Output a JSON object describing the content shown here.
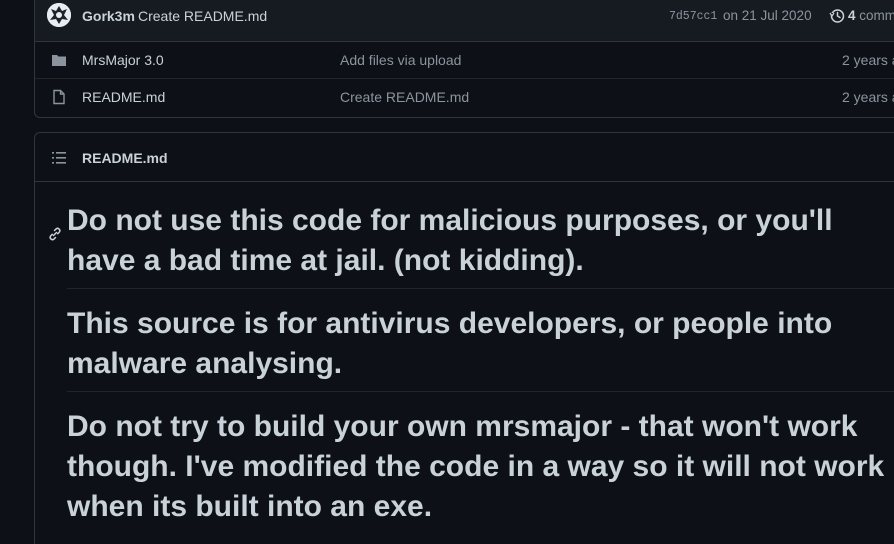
{
  "commit": {
    "author": "Gork3m",
    "message": "Create README.md",
    "sha": "7d57cc1",
    "date": "on 21 Jul 2020",
    "count": "4",
    "count_label": "comm"
  },
  "files": [
    {
      "name": "MrsMajor 3.0",
      "type": "folder",
      "commit": "Add files via upload",
      "age": "2 years a"
    },
    {
      "name": "README.md",
      "type": "file",
      "commit": "Create README.md",
      "age": "2 years a"
    }
  ],
  "readme": {
    "title": "README.md",
    "headings": [
      "Do not use this code for malicious purposes, or you'll have a bad time at jail. (not kidding).",
      "This source is for antivirus developers, or people into malware analysing.",
      "Do not try to build your own mrsmajor - that won't work though. I've modified the code in a way so it will not work when its built into an exe."
    ]
  },
  "icons": {
    "folder": "folder-icon",
    "file": "file-icon",
    "history": "history-icon",
    "list": "list-icon",
    "anchor": "link-icon"
  },
  "colors": {
    "background": "#0d1117",
    "surface": "#161b22",
    "border": "#30363d",
    "text": "#c9d1d9",
    "muted": "#8b949e"
  }
}
